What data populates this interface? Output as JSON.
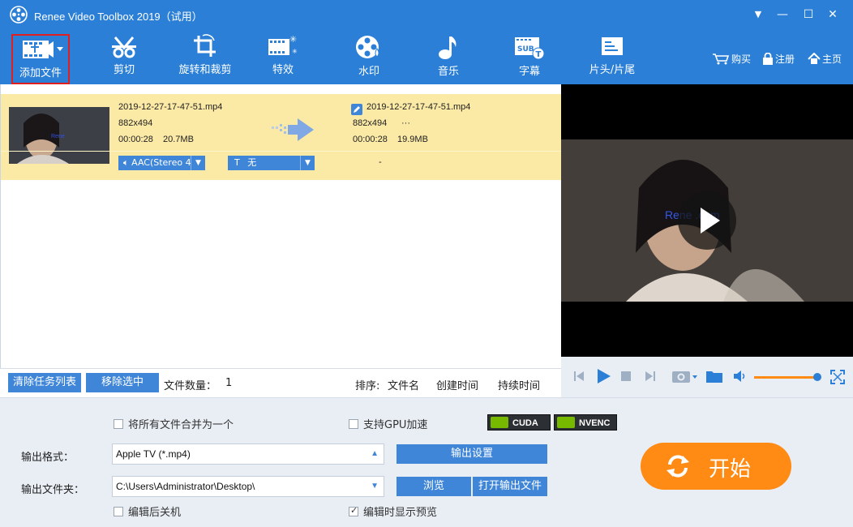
{
  "window": {
    "title": "Renee Video Toolbox 2019（试用）",
    "minimize_glyph": "—",
    "maximize_glyph": "☐",
    "close_glyph": "✕",
    "menu_glyph": "▼"
  },
  "toolbar": {
    "items": [
      {
        "label": "添加文件",
        "icon": "add-file-icon"
      },
      {
        "label": "剪切",
        "icon": "cut-icon"
      },
      {
        "label": "旋转和裁剪",
        "icon": "rotate-crop-icon"
      },
      {
        "label": "特效",
        "icon": "effects-icon"
      },
      {
        "label": "水印",
        "icon": "watermark-icon"
      },
      {
        "label": "音乐",
        "icon": "music-icon"
      },
      {
        "label": "字幕",
        "icon": "subtitle-icon"
      },
      {
        "label": "片头/片尾",
        "icon": "intro-outro-icon"
      }
    ],
    "buy": "购买",
    "register": "注册",
    "home": "主页"
  },
  "task": {
    "source": {
      "filename": "2019-12-27-17-47-51.mp4",
      "resolution": "882x494",
      "duration": "00:00:28",
      "size": "20.7MB"
    },
    "output": {
      "filename": "2019-12-27-17-47-51.mp4",
      "resolution": "882x494",
      "extra": "···",
      "duration": "00:00:28",
      "size": "19.9MB"
    },
    "audio_track": "AAC(Stereo 4",
    "subtitle": "无",
    "subtitle_prefix": "T",
    "output_dash": "-"
  },
  "listbar": {
    "clear": "清除任务列表",
    "remove": "移除选中",
    "file_count_label": "文件数量：",
    "file_count": "1",
    "sort_label": "排序:",
    "sort_name": "文件名",
    "sort_created": "创建时间",
    "sort_duration": "持续时间"
  },
  "preview": {
    "watermark_text": "Rene        .com",
    "volume_fraction": 0.98
  },
  "settings": {
    "merge_label": "将所有文件合并为一个",
    "merge_checked": false,
    "gpu_label": "支持GPU加速",
    "gpu_checked": false,
    "cuda": "CUDA",
    "nvenc": "NVENC",
    "format_label": "输出格式：",
    "format_value": "Apple TV (*.mp4)",
    "output_settings": "输出设置",
    "folder_label": "输出文件夹：",
    "folder_value": "C:\\Users\\Administrator\\Desktop\\",
    "browse": "浏览",
    "open_output": "打开输出文件",
    "shutdown_label": "编辑后关机",
    "shutdown_checked": false,
    "preview_label": "编辑时显示预览",
    "preview_checked": true,
    "start": "开始"
  },
  "colors": {
    "brand_blue": "#2b7fd6",
    "task_highlight": "#fbe9a6",
    "start_orange": "#ff8a14",
    "nvidia_green": "#76b900"
  }
}
